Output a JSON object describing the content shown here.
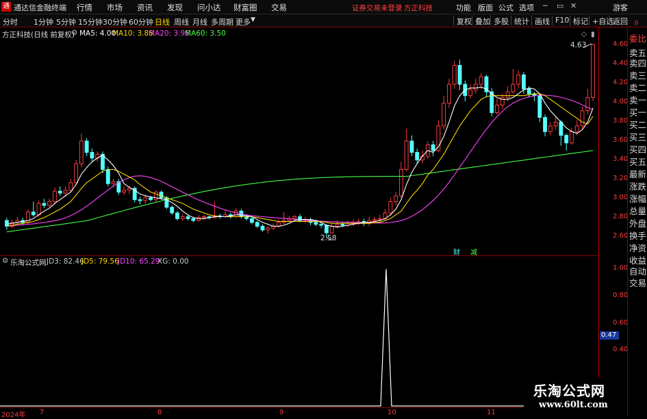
{
  "app": {
    "title": "通达信金融终端",
    "logo_char": "通",
    "menu": [
      "行情",
      "市场",
      "资讯",
      "发现",
      "问小达",
      "财富圈",
      "交易"
    ],
    "warning": "证券交易未登录",
    "broker": "方正科技",
    "right_menu": [
      "功能",
      "版面",
      "公式",
      "选项"
    ],
    "guest": "游客"
  },
  "periods": {
    "items": [
      "分时",
      "1分钟",
      "5分钟",
      "15分钟",
      "30分钟",
      "60分钟",
      "日线",
      "周线",
      "月线",
      "多周期",
      "更多"
    ],
    "active": "日线",
    "tools": [
      "复权",
      "叠加",
      "多股",
      "统计",
      "画线",
      "F10",
      "标记",
      "+自选",
      "返回"
    ]
  },
  "main_chart": {
    "stock_title": "方正科技(日线 前复权)",
    "ma_legends": [
      {
        "label": "MA5: 4.00",
        "color": "#ffffff"
      },
      {
        "label": "MA10: 3.86",
        "color": "#ffd700"
      },
      {
        "label": "MA20: 3.96",
        "color": "#ff44ff"
      },
      {
        "label": "MA60: 3.50",
        "color": "#44ff44"
      }
    ],
    "high_label": "4.63",
    "low_label": "2.58",
    "badge1": "财",
    "badge2": "减"
  },
  "indicator": {
    "title": "乐淘公式网",
    "legends": [
      {
        "label": "JD3: 82.46",
        "color": "#ffffff"
      },
      {
        "label": "JD5: 79.56",
        "color": "#ffd700"
      },
      {
        "label": "JD10: 65.29",
        "color": "#ff44ff"
      },
      {
        "label": "XG: 0.00",
        "color": "#ffffff"
      }
    ],
    "current_value": "0.47"
  },
  "axis": {
    "main_ticks": [
      "4.60",
      "4.40",
      "4.20",
      "4.00",
      "3.80",
      "3.60",
      "3.40",
      "3.20",
      "3.00",
      "2.80",
      "2.60"
    ],
    "ind_ticks": [
      "1.00",
      "0.80",
      "0.60",
      "0.40"
    ],
    "x_labels": [
      "2024年",
      "7",
      "8",
      "9",
      "10",
      "11"
    ]
  },
  "side_panel": {
    "items": [
      "委比",
      "卖五",
      "卖四",
      "卖三",
      "卖二",
      "卖一",
      "买一",
      "买二",
      "买三",
      "买四",
      "买五",
      "最新",
      "涨跌",
      "涨幅",
      "总量",
      "外盘",
      "换手",
      "净资",
      "收益"
    ],
    "bottom_items": [
      "自动",
      "交易"
    ],
    "top_marker": "0"
  },
  "watermark": {
    "line1": "乐淘公式网",
    "line2": "www.60lt.com"
  },
  "colors": {
    "up": "#ff3c3c",
    "down": "#54ffff",
    "ma5": "#ffffff",
    "ma10": "#ffd700",
    "ma20": "#ff44ff",
    "ma60": "#44ff44",
    "axis_red": "#c00000"
  },
  "chart_data": {
    "type": "candlestick",
    "ylim": [
      2.5,
      4.7
    ],
    "candles": [
      [
        2.76,
        2.7,
        2.79,
        2.66
      ],
      [
        2.7,
        2.74,
        2.77,
        2.68
      ],
      [
        2.74,
        2.76,
        2.8,
        2.72
      ],
      [
        2.76,
        2.74,
        2.79,
        2.71
      ],
      [
        2.74,
        2.85,
        2.88,
        2.72
      ],
      [
        2.85,
        2.82,
        2.96,
        2.8
      ],
      [
        2.82,
        2.94,
        2.97,
        2.8
      ],
      [
        2.94,
        2.92,
        2.99,
        2.89
      ],
      [
        2.92,
        2.96,
        2.99,
        2.89
      ],
      [
        2.96,
        3.07,
        3.11,
        2.93
      ],
      [
        3.07,
        3.05,
        3.12,
        3.02
      ],
      [
        3.05,
        3.08,
        3.12,
        3.01
      ],
      [
        3.08,
        3.16,
        3.2,
        3.06
      ],
      [
        3.16,
        3.36,
        3.4,
        3.13
      ],
      [
        3.36,
        3.6,
        3.68,
        3.32
      ],
      [
        3.6,
        3.48,
        3.63,
        3.44
      ],
      [
        3.48,
        3.42,
        3.52,
        3.38
      ],
      [
        3.42,
        3.46,
        3.49,
        3.38
      ],
      [
        3.46,
        3.3,
        3.49,
        3.26
      ],
      [
        3.3,
        3.15,
        3.33,
        3.12
      ],
      [
        3.15,
        3.17,
        3.2,
        3.11
      ],
      [
        3.17,
        3.06,
        3.2,
        3.03
      ],
      [
        3.06,
        3.08,
        3.12,
        3.03
      ],
      [
        3.08,
        3.1,
        3.13,
        3.04
      ],
      [
        3.1,
        2.98,
        3.12,
        2.95
      ],
      [
        2.98,
        2.97,
        3.01,
        2.93
      ],
      [
        2.97,
        3.0,
        3.04,
        2.94
      ],
      [
        3.0,
        2.98,
        3.02,
        2.96
      ],
      [
        2.98,
        3.06,
        3.08,
        2.95
      ],
      [
        3.06,
        3.0,
        3.08,
        2.98
      ],
      [
        3.0,
        2.9,
        3.02,
        2.88
      ],
      [
        2.9,
        2.84,
        2.92,
        2.82
      ],
      [
        2.84,
        2.78,
        2.86,
        2.76
      ],
      [
        2.78,
        2.8,
        2.83,
        2.76
      ],
      [
        2.8,
        2.78,
        2.82,
        2.76
      ],
      [
        2.78,
        2.76,
        2.8,
        2.74
      ],
      [
        2.76,
        2.79,
        2.82,
        2.75
      ],
      [
        2.79,
        2.8,
        2.82,
        2.77
      ],
      [
        2.8,
        2.79,
        2.81,
        2.77
      ],
      [
        2.79,
        2.81,
        2.96,
        2.78
      ],
      [
        2.81,
        2.8,
        2.83,
        2.78
      ],
      [
        2.8,
        2.82,
        2.88,
        2.79
      ],
      [
        2.82,
        2.8,
        2.84,
        2.78
      ],
      [
        2.8,
        2.86,
        2.89,
        2.79
      ],
      [
        2.86,
        2.8,
        2.88,
        2.78
      ],
      [
        2.8,
        2.78,
        2.82,
        2.76
      ],
      [
        2.78,
        2.74,
        2.8,
        2.72
      ],
      [
        2.74,
        2.7,
        2.76,
        2.68
      ],
      [
        2.7,
        2.66,
        2.72,
        2.64
      ],
      [
        2.66,
        2.68,
        2.7,
        2.62
      ],
      [
        2.68,
        2.7,
        2.73,
        2.66
      ],
      [
        2.7,
        2.74,
        2.77,
        2.68
      ],
      [
        2.74,
        2.76,
        2.85,
        2.72
      ],
      [
        2.76,
        2.78,
        2.81,
        2.74
      ],
      [
        2.78,
        2.8,
        2.82,
        2.76
      ],
      [
        2.8,
        2.76,
        2.83,
        2.74
      ],
      [
        2.76,
        2.77,
        2.8,
        2.73
      ],
      [
        2.77,
        2.74,
        2.79,
        2.71
      ],
      [
        2.74,
        2.72,
        2.77,
        2.7
      ],
      [
        2.72,
        2.71,
        2.74,
        2.68
      ],
      [
        2.71,
        2.63,
        2.72,
        2.58
      ],
      [
        2.63,
        2.7,
        2.74,
        2.62
      ],
      [
        2.7,
        2.72,
        2.76,
        2.68
      ],
      [
        2.72,
        2.71,
        2.74,
        2.69
      ],
      [
        2.71,
        2.73,
        2.76,
        2.69
      ],
      [
        2.73,
        2.74,
        2.77,
        2.7
      ],
      [
        2.74,
        2.75,
        2.78,
        2.71
      ],
      [
        2.75,
        2.73,
        2.78,
        2.7
      ],
      [
        2.73,
        2.76,
        2.8,
        2.7
      ],
      [
        2.76,
        2.77,
        2.8,
        2.73
      ],
      [
        2.77,
        2.78,
        2.82,
        2.74
      ],
      [
        2.78,
        2.84,
        2.88,
        2.76
      ],
      [
        2.84,
        2.96,
        3.0,
        2.82
      ],
      [
        2.96,
        3.02,
        3.06,
        2.92
      ],
      [
        3.02,
        3.3,
        3.38,
        3.0
      ],
      [
        3.3,
        3.6,
        3.73,
        3.28
      ],
      [
        3.6,
        3.48,
        3.66,
        3.44
      ],
      [
        3.48,
        3.4,
        3.52,
        3.36
      ],
      [
        3.4,
        3.44,
        3.5,
        3.36
      ],
      [
        3.44,
        3.56,
        3.6,
        3.41
      ],
      [
        3.56,
        3.5,
        3.6,
        3.44
      ],
      [
        3.5,
        3.76,
        3.82,
        3.48
      ],
      [
        3.76,
        4.0,
        4.08,
        3.72
      ],
      [
        4.0,
        4.2,
        4.26,
        3.95
      ],
      [
        4.2,
        4.4,
        4.45,
        4.15
      ],
      [
        4.4,
        4.2,
        4.46,
        4.14
      ],
      [
        4.2,
        4.08,
        4.24,
        4.02
      ],
      [
        4.08,
        4.14,
        4.2,
        4.05
      ],
      [
        4.14,
        4.2,
        4.26,
        4.1
      ],
      [
        4.2,
        4.28,
        4.32,
        4.15
      ],
      [
        4.28,
        4.12,
        4.3,
        4.06
      ],
      [
        4.12,
        3.9,
        4.16,
        3.86
      ],
      [
        3.9,
        3.98,
        4.05,
        3.88
      ],
      [
        3.98,
        4.06,
        4.1,
        3.94
      ],
      [
        4.06,
        4.12,
        4.18,
        4.02
      ],
      [
        4.12,
        4.2,
        4.36,
        4.1
      ],
      [
        4.2,
        4.3,
        4.35,
        4.16
      ],
      [
        4.3,
        4.15,
        4.33,
        4.1
      ],
      [
        4.15,
        4.1,
        4.18,
        4.06
      ],
      [
        4.1,
        4.08,
        4.12,
        4.02
      ],
      [
        4.08,
        3.85,
        4.1,
        3.8
      ],
      [
        3.85,
        3.7,
        3.88,
        3.65
      ],
      [
        3.7,
        3.76,
        3.8,
        3.66
      ],
      [
        3.76,
        3.8,
        3.86,
        3.72
      ],
      [
        3.8,
        3.66,
        3.82,
        3.55
      ],
      [
        3.66,
        3.58,
        3.68,
        3.5
      ],
      [
        3.58,
        3.7,
        3.74,
        3.56
      ],
      [
        3.7,
        3.76,
        3.82,
        3.66
      ],
      [
        3.76,
        3.92,
        3.96,
        3.72
      ],
      [
        3.92,
        4.06,
        4.15,
        3.88
      ],
      [
        4.06,
        4.62,
        4.63,
        4.02
      ]
    ],
    "ma5": [
      2.72,
      2.73,
      2.74,
      2.75,
      2.76,
      2.78,
      2.82,
      2.86,
      2.89,
      2.94,
      2.98,
      3.02,
      3.06,
      3.14,
      3.25,
      3.32,
      3.38,
      3.42,
      3.45,
      3.4,
      3.34,
      3.26,
      3.15,
      3.11,
      3.08,
      3.04,
      3.02,
      3.01,
      3.0,
      2.99,
      2.98,
      2.95,
      2.91,
      2.86,
      2.82,
      2.79,
      2.78,
      2.78,
      2.79,
      2.8,
      2.8,
      2.8,
      2.81,
      2.82,
      2.82,
      2.81,
      2.8,
      2.77,
      2.74,
      2.72,
      2.7,
      2.7,
      2.71,
      2.73,
      2.76,
      2.77,
      2.77,
      2.77,
      2.76,
      2.74,
      2.71,
      2.7,
      2.69,
      2.7,
      2.71,
      2.72,
      2.73,
      2.74,
      2.74,
      2.75,
      2.76,
      2.78,
      2.82,
      2.88,
      2.98,
      3.14,
      3.27,
      3.36,
      3.44,
      3.5,
      3.48,
      3.54,
      3.65,
      3.8,
      3.97,
      4.08,
      4.14,
      4.16,
      4.16,
      4.17,
      4.15,
      4.1,
      4.06,
      4.04,
      4.04,
      4.06,
      4.1,
      4.14,
      4.16,
      4.15,
      4.1,
      4.0,
      3.92,
      3.86,
      3.8,
      3.74,
      3.7,
      3.68,
      3.72,
      3.8,
      3.95
    ],
    "ma10": [
      2.7,
      2.71,
      2.72,
      2.73,
      2.74,
      2.75,
      2.77,
      2.79,
      2.82,
      2.85,
      2.88,
      2.92,
      2.96,
      3.03,
      3.1,
      3.16,
      3.2,
      3.24,
      3.28,
      3.3,
      3.3,
      3.28,
      3.25,
      3.22,
      3.19,
      3.14,
      3.1,
      3.06,
      3.04,
      3.02,
      3.0,
      2.98,
      2.96,
      2.94,
      2.91,
      2.88,
      2.86,
      2.84,
      2.82,
      2.81,
      2.8,
      2.8,
      2.8,
      2.8,
      2.8,
      2.8,
      2.8,
      2.79,
      2.78,
      2.77,
      2.76,
      2.75,
      2.75,
      2.75,
      2.75,
      2.75,
      2.75,
      2.75,
      2.75,
      2.75,
      2.74,
      2.73,
      2.73,
      2.73,
      2.73,
      2.73,
      2.73,
      2.73,
      2.73,
      2.74,
      2.74,
      2.76,
      2.78,
      2.82,
      2.86,
      2.94,
      3.02,
      3.08,
      3.15,
      3.24,
      3.3,
      3.38,
      3.46,
      3.56,
      3.66,
      3.76,
      3.84,
      3.92,
      3.98,
      4.04,
      4.07,
      4.08,
      4.08,
      4.08,
      4.08,
      4.08,
      4.08,
      4.08,
      4.09,
      4.1,
      4.1,
      4.08,
      4.04,
      4.0,
      3.96,
      3.92,
      3.88,
      3.84,
      3.8,
      3.78,
      3.86
    ]
  }
}
